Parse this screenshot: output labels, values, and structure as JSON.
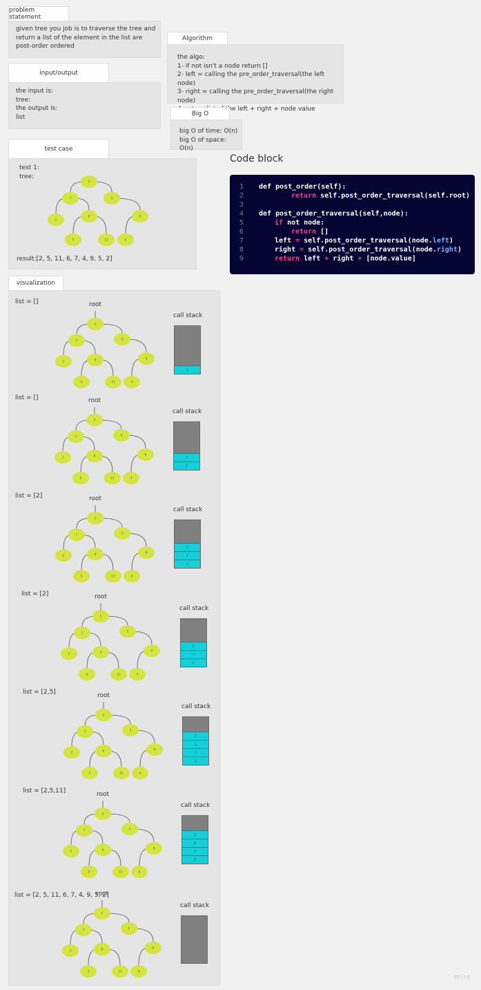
{
  "problem": {
    "title": "problem statement",
    "lines": [
      "given tree you job is to traverse  the tree and",
      "return a list of the element in the list are",
      "post-order ordered"
    ]
  },
  "io": {
    "title": "input/output",
    "lines": [
      "the input is:",
      "tree:",
      "the output is:",
      "list"
    ]
  },
  "algorithm": {
    "title": "Algorithm",
    "lines": [
      "the algo:",
      "1- if not isn't a node return []",
      "2- left = calling the pre_order_traversal(the left node)",
      "3- right = calling the pre_order_traversal(the right node)",
      "4- return list of the left + right + node value"
    ]
  },
  "bigo": {
    "title": "Big O",
    "lines": [
      "big O of time: O(n)",
      "big O of space: O(n)"
    ]
  },
  "testcase": {
    "title": "test case",
    "label1": "test 1:",
    "label2": "tree:",
    "result": "result:[2, 5, 11, 6, 7, 4, 9, 5, 2]"
  },
  "code": {
    "title": "Code block",
    "line_numbers": [
      "1",
      "2",
      "3",
      "4",
      "5",
      "6",
      "7",
      "8",
      "9"
    ]
  },
  "tree_values": [
    "2",
    "7",
    "5",
    "2",
    "6",
    "9",
    "5",
    "11",
    "4"
  ],
  "visualization": {
    "title": "visualization",
    "root_label": "root",
    "stack_label": "call stack",
    "steps": [
      {
        "list": "list = []",
        "frames": [
          "2"
        ]
      },
      {
        "list": "list = []",
        "frames": [
          "7",
          "2"
        ]
      },
      {
        "list": "list = [2]",
        "frames": [
          "2",
          "7",
          "2"
        ]
      },
      {
        "list": "list = [2]",
        "frames": [
          "6",
          "7",
          "2"
        ]
      },
      {
        "list": "list = [2,5]",
        "frames": [
          "5",
          "6",
          "7",
          "2"
        ]
      },
      {
        "list": "list = [2,5,11]",
        "frames": [
          "11",
          "6",
          "7",
          "2"
        ]
      },
      {
        "list": "list = [2, 5, 11, 6, 7, 4, 9, 5, 2]",
        "frames": []
      }
    ]
  },
  "watermark": "miro"
}
